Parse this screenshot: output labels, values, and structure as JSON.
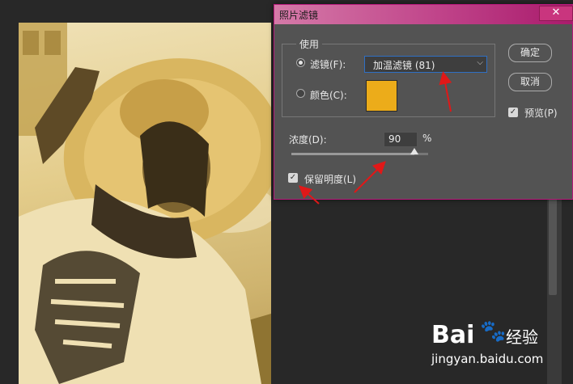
{
  "dialog": {
    "title": "照片滤镜",
    "close_label": "✕",
    "use_group_label": "使用",
    "filter_radio_label": "滤镜(F):",
    "filter_selected": "加温滤镜 (81)",
    "color_radio_label": "颜色(C):",
    "swatch_color": "#ecac1a",
    "ok_label": "确定",
    "cancel_label": "取消",
    "preview_label": "预览(P)",
    "preview_checked": true,
    "density_label": "浓度(D):",
    "density_value": "90",
    "density_percent": 90,
    "percent_sign": "%",
    "preserve_luminosity_label": "保留明度(L)",
    "preserve_luminosity_checked": true,
    "selected_option": "filter"
  },
  "watermark": {
    "logo": "Bai",
    "paw": "🐾",
    "brand": "经验",
    "site": "jingyan.baidu.com"
  },
  "colors": {
    "title_gradient_end": "#a91b6c",
    "annotation_arrow": "#e01818"
  }
}
